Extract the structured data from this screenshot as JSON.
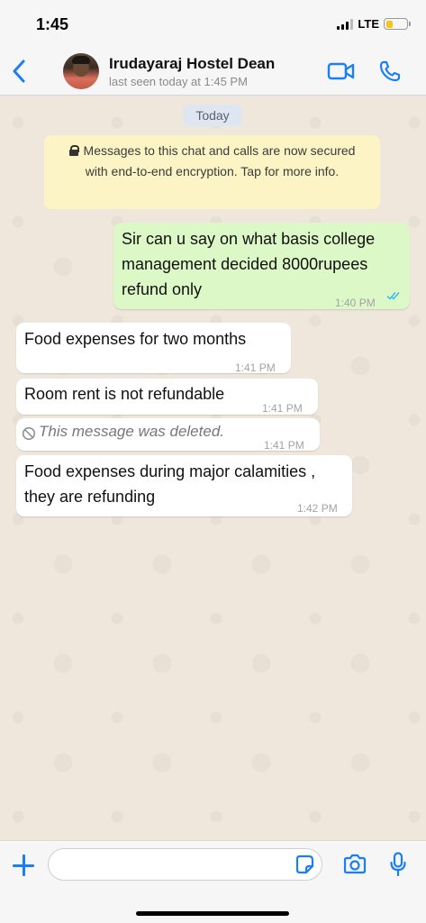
{
  "status_bar": {
    "time": "1:45",
    "network": "LTE"
  },
  "header": {
    "contact_name": "Irudayaraj Hostel Dean",
    "last_seen": "last seen today at 1:45 PM",
    "accent_color": "#1a7ef7"
  },
  "chat": {
    "date_chip": "Today",
    "encryption_notice": "Messages to this chat and calls are now secured with end-to-end encryption. Tap for more info.",
    "messages": [
      {
        "direction": "outgoing",
        "text": "Sir can u say on what basis college management decided 8000rupees refund only",
        "time": "1:40 PM",
        "status": "read"
      },
      {
        "direction": "incoming",
        "text": "Food expenses for two months",
        "time": "1:41 PM"
      },
      {
        "direction": "incoming",
        "text": "Room rent is not refundable",
        "time": "1:41 PM"
      },
      {
        "direction": "incoming",
        "text": "This message was deleted.",
        "time": "1:41 PM",
        "deleted": true
      },
      {
        "direction": "incoming",
        "text": "Food expenses during major calamities , they are refunding",
        "time": "1:42 PM"
      }
    ]
  },
  "composer": {
    "placeholder": "",
    "value": ""
  },
  "colors": {
    "outgoing_bubble": "#dcf8c6",
    "incoming_bubble": "#ffffff",
    "read_ticks": "#34b7f1",
    "notice_background": "#fdf4c5"
  }
}
